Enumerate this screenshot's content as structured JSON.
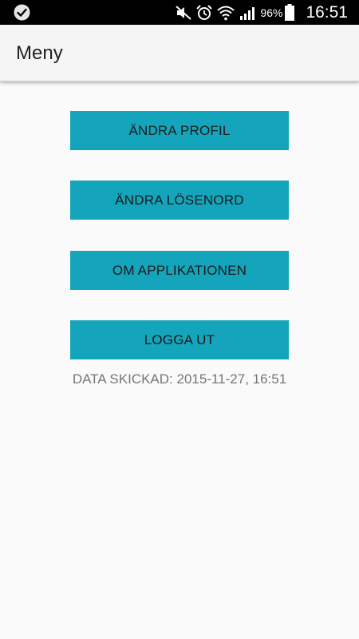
{
  "status_bar": {
    "left_icon": "check-notification-icon",
    "icons": [
      "mute-icon",
      "alarm-icon",
      "wifi-icon",
      "signal-icon",
      "battery-icon"
    ],
    "battery_percent": "96%",
    "time": "16:51"
  },
  "app_bar": {
    "title": "Meny"
  },
  "menu": {
    "buttons": [
      {
        "label": "ÄNDRA PROFIL"
      },
      {
        "label": "ÄNDRA LÖSENORD"
      },
      {
        "label": "OM APPLIKATIONEN"
      },
      {
        "label": "LOGGA UT"
      }
    ],
    "data_sent": "DATA SKICKAD: 2015-11-27, 16:51"
  },
  "colors": {
    "button": "#14a5bd",
    "background": "#fafafa",
    "app_bar": "#f5f5f5",
    "status_bar": "#000000"
  }
}
